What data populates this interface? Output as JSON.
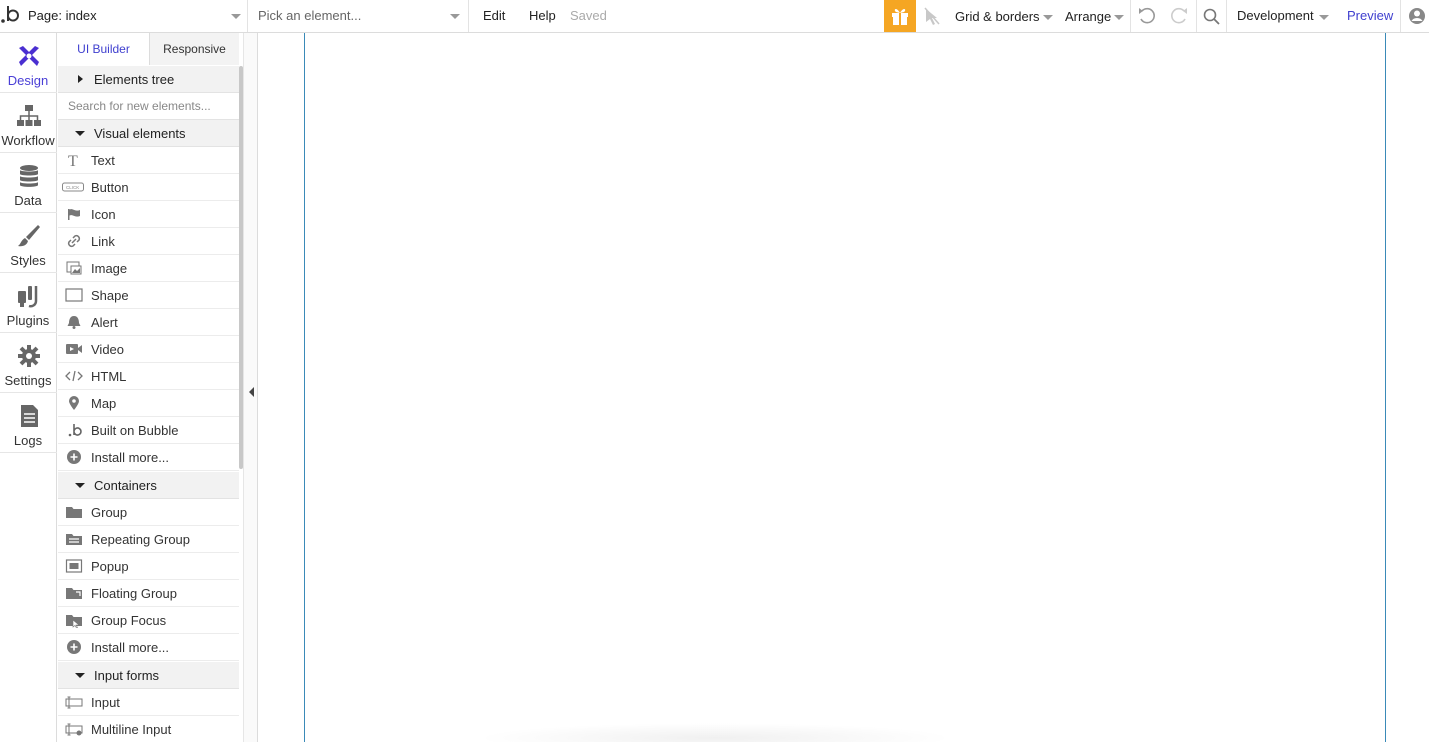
{
  "topbar": {
    "page_label": "Page: index",
    "pick_placeholder": "Pick an element...",
    "menu_edit": "Edit",
    "menu_help": "Help",
    "status": "Saved",
    "grid_borders": "Grid & borders",
    "arrange": "Arrange",
    "environment": "Development",
    "preview": "Preview",
    "accent_color": "#3f3fcf",
    "gift_color": "#f5a623"
  },
  "rail": {
    "items": [
      {
        "label": "Design",
        "icon": "design-icon"
      },
      {
        "label": "Workflow",
        "icon": "workflow-icon"
      },
      {
        "label": "Data",
        "icon": "database-icon"
      },
      {
        "label": "Styles",
        "icon": "brush-icon"
      },
      {
        "label": "Plugins",
        "icon": "plugins-icon"
      },
      {
        "label": "Settings",
        "icon": "gear-icon"
      },
      {
        "label": "Logs",
        "icon": "logs-icon"
      }
    ]
  },
  "panel": {
    "tabs": [
      {
        "label": "UI Builder"
      },
      {
        "label": "Responsive"
      }
    ],
    "elements_tree": "Elements tree",
    "search_placeholder": "Search for new elements...",
    "sections": {
      "visual": {
        "title": "Visual elements",
        "items": [
          {
            "label": "Text",
            "icon": "text-icon"
          },
          {
            "label": "Button",
            "icon": "button-icon"
          },
          {
            "label": "Icon",
            "icon": "flag-icon"
          },
          {
            "label": "Link",
            "icon": "link-icon"
          },
          {
            "label": "Image",
            "icon": "image-icon"
          },
          {
            "label": "Shape",
            "icon": "shape-icon"
          },
          {
            "label": "Alert",
            "icon": "bell-icon"
          },
          {
            "label": "Video",
            "icon": "video-icon"
          },
          {
            "label": "HTML",
            "icon": "code-icon"
          },
          {
            "label": "Map",
            "icon": "map-pin-icon"
          },
          {
            "label": "Built on Bubble",
            "icon": "bubble-logo-icon"
          },
          {
            "label": "Install more...",
            "icon": "plus-circle-icon"
          }
        ]
      },
      "containers": {
        "title": "Containers",
        "items": [
          {
            "label": "Group",
            "icon": "folder-icon"
          },
          {
            "label": "Repeating Group",
            "icon": "repeating-group-icon"
          },
          {
            "label": "Popup",
            "icon": "popup-icon"
          },
          {
            "label": "Floating Group",
            "icon": "floating-group-icon"
          },
          {
            "label": "Group Focus",
            "icon": "group-focus-icon"
          },
          {
            "label": "Install more...",
            "icon": "plus-circle-icon"
          }
        ]
      },
      "inputs": {
        "title": "Input forms",
        "items": [
          {
            "label": "Input",
            "icon": "input-icon"
          },
          {
            "label": "Multiline Input",
            "icon": "multiline-input-icon"
          }
        ]
      }
    }
  }
}
